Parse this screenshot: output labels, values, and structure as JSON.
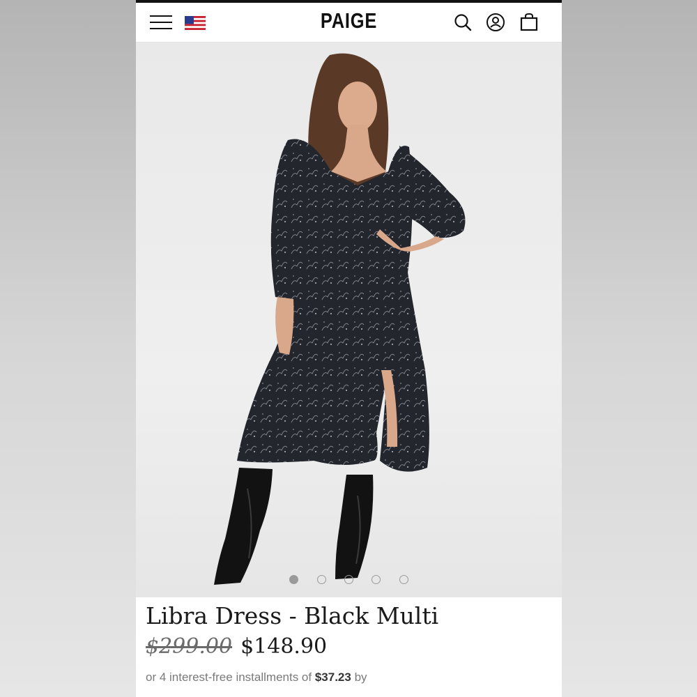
{
  "header": {
    "brand": "PAIGE",
    "icons": [
      "menu-icon",
      "us-flag-icon",
      "search-icon",
      "account-icon",
      "bag-icon"
    ]
  },
  "gallery": {
    "slide_count": 5,
    "active_slide": 1
  },
  "product": {
    "name": "Libra Dress - Black Multi",
    "original_price": "$299.00",
    "sale_price": "$148.90",
    "installments_prefix": "or 4 interest-free installments of",
    "installment_amount": "$37.23",
    "installments_suffix": "by"
  },
  "colors": {
    "text": "#1a1a1a",
    "muted": "#7a7a7a",
    "dress": "#22252c",
    "skin": "#d9a88a",
    "hair": "#5a3a26"
  }
}
